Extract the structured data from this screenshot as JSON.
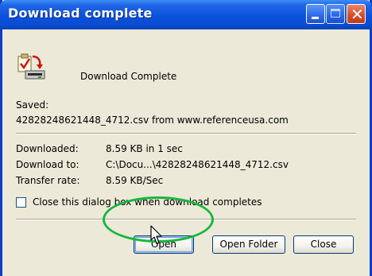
{
  "window": {
    "title": "Download complete",
    "controls": {
      "minimize": "minimize",
      "maximize": "maximize",
      "close": "close"
    }
  },
  "header": {
    "message": "Download Complete",
    "icon": "download-complete-icon"
  },
  "saved": {
    "label": "Saved:",
    "file_line": "42828248621448_4712.csv from www.referenceusa.com"
  },
  "details": [
    {
      "label": "Downloaded:",
      "value": "8.59 KB in 1 sec"
    },
    {
      "label": "Download to:",
      "value": "C:\\Docu...\\42828248621448_4712.csv"
    },
    {
      "label": "Transfer rate:",
      "value": "8.59 KB/Sec"
    }
  ],
  "checkbox": {
    "label": "Close this dialog box when download completes",
    "checked": false
  },
  "buttons": {
    "open": "Open",
    "open_folder": "Open Folder",
    "close": "Close"
  },
  "colors": {
    "title_bar": "#0a52dc",
    "dialog_bg": "#ece9d8",
    "highlight_ring": "#16b83c"
  }
}
